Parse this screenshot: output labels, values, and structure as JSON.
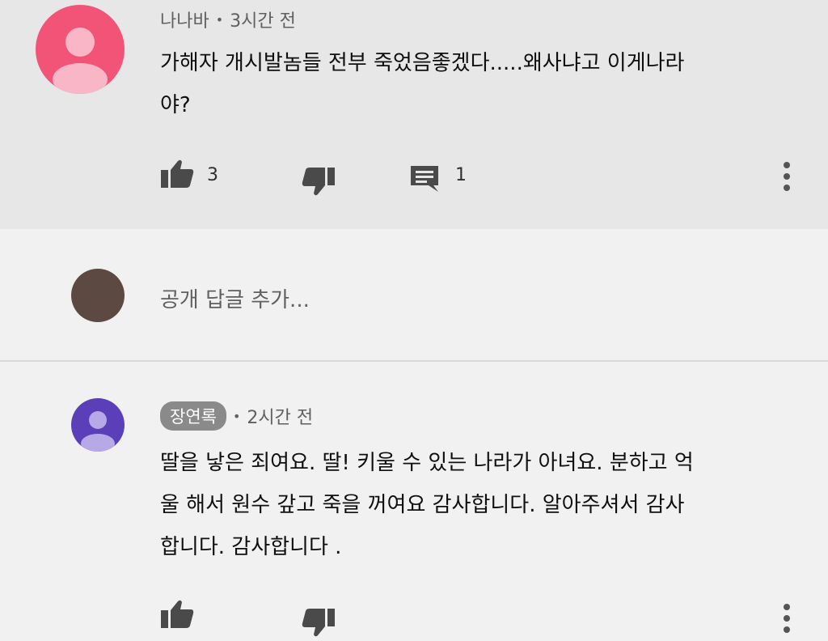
{
  "comment1": {
    "author": "나나바",
    "time": "3시간 전",
    "text_line1": "가해자 개시발놈들 전부 죽었음좋겠다.....왜사냐고 이게나라",
    "text_line2": "야?",
    "likes": "3",
    "replies": "1",
    "avatar_color": "#f25478"
  },
  "reply_box": {
    "placeholder": "공개 답글 추가..."
  },
  "comment2": {
    "author": "장연록",
    "time": "2시간 전",
    "text_line1": "딸을 낳은 죄여요. 딸! 키울 수 있는 나라가 아녀요. 분하고 억",
    "text_line2": "울 해서  원수 갚고 죽을 꺼여요 감사합니다. 알아주셔서 감사",
    "text_line3": "합니다. 감사합니다 .",
    "avatar_color": "#5a3fb8"
  },
  "icons": {
    "like": "thumb-up-icon",
    "dislike": "thumb-down-icon",
    "reply": "comment-icon",
    "more": "more-vert-icon"
  }
}
